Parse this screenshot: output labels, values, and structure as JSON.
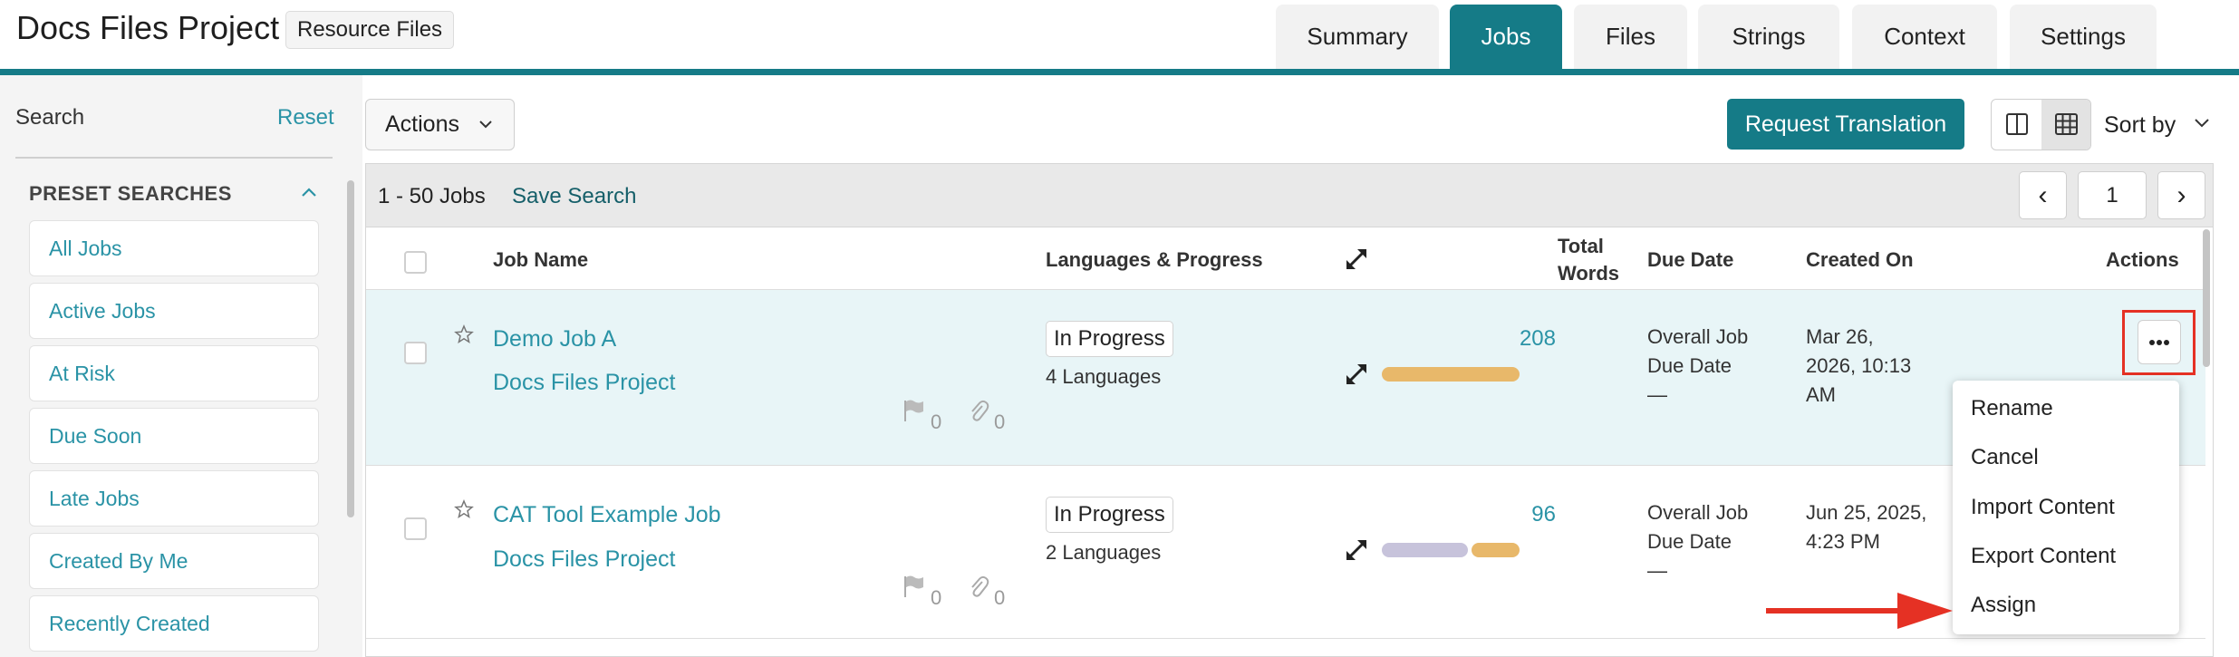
{
  "header": {
    "project_title": "Docs Files Project",
    "resource_badge": "Resource Files",
    "tabs": [
      {
        "label": "Summary",
        "active": false
      },
      {
        "label": "Jobs",
        "active": true
      },
      {
        "label": "Files",
        "active": false
      },
      {
        "label": "Strings",
        "active": false
      },
      {
        "label": "Context",
        "active": false
      },
      {
        "label": "Settings",
        "active": false
      }
    ]
  },
  "sidebar": {
    "search_label": "Search",
    "reset_label": "Reset",
    "preset_header": "PRESET SEARCHES",
    "presets": [
      "All Jobs",
      "Active Jobs",
      "At Risk",
      "Due Soon",
      "Late Jobs",
      "Created By Me",
      "Recently Created"
    ]
  },
  "toolbar": {
    "actions_label": "Actions",
    "request_translation_label": "Request Translation",
    "sort_by_label": "Sort by"
  },
  "list": {
    "jobs_count": "1 - 50 Jobs",
    "save_search_label": "Save Search",
    "page_number": "1",
    "prev_glyph": "‹",
    "next_glyph": "›",
    "columns": {
      "job_name": "Job Name",
      "languages_progress": "Languages & Progress",
      "total_words_line1": "Total",
      "total_words_line2": "Words",
      "due_date": "Due Date",
      "created_on": "Created On",
      "actions": "Actions"
    },
    "rows": [
      {
        "job_name": "Demo Job A",
        "project": "Docs Files Project",
        "status": "In Progress",
        "languages": "4 Languages",
        "issues": "0",
        "attachments": "0",
        "total_words": "208",
        "due_line1": "Overall Job",
        "due_line2": "Due Date",
        "due_line3": "—",
        "created_line1": "Mar 26,",
        "created_line2": "2026, 10:13",
        "created_line3": "AM",
        "progress_colors": [
          "#e8b86a"
        ],
        "highlighted": true
      },
      {
        "job_name": "CAT Tool Example Job",
        "project": "Docs Files Project",
        "status": "In Progress",
        "languages": "2 Languages",
        "issues": "0",
        "attachments": "0",
        "total_words": "96",
        "due_line1": "Overall Job",
        "due_line2": "Due Date",
        "due_line3": "—",
        "created_line1": "Jun 25, 2025,",
        "created_line2": "4:23 PM",
        "created_line3": "",
        "progress_colors": [
          "#c7c3db",
          "#e8b86a"
        ],
        "highlighted": false
      }
    ]
  },
  "row_menu": {
    "more_glyph": "•••",
    "items": [
      "Rename",
      "Cancel",
      "Import Content",
      "Export Content",
      "Assign"
    ]
  },
  "colors": {
    "brand_teal": "#157b87",
    "link_teal": "#2a93a6",
    "row_highlight": "#e8f5f7",
    "annotation_red": "#e53124"
  }
}
